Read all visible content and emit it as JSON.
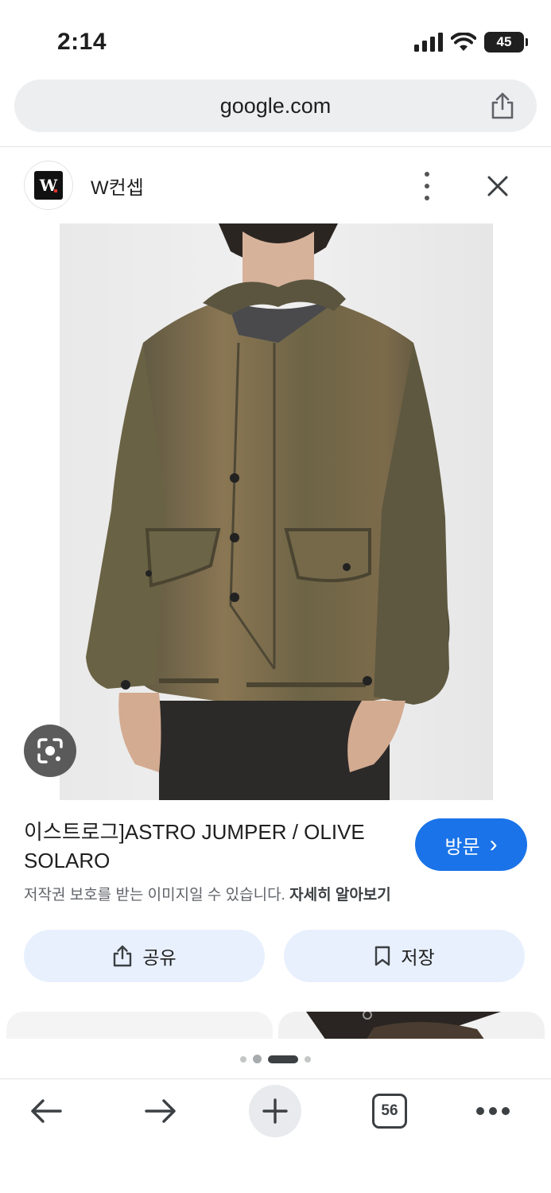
{
  "status_bar": {
    "time": "2:14",
    "battery": "45"
  },
  "address_bar": {
    "url": "google.com"
  },
  "source": {
    "name": "W컨셉",
    "logo_text": "W"
  },
  "product": {
    "title": "이스트로그]ASTRO JUMPER / OLIVE SOLARO",
    "visit_label": "방문",
    "visit_chevron": "›",
    "copyright_text": "저작권 보호를 받는 이미지일 수 있습니다.",
    "learn_more": "자세히 알아보기"
  },
  "actions": {
    "share_label": "공유",
    "save_label": "저장"
  },
  "pager": {
    "count": 4,
    "active_index": 2
  },
  "toolbar": {
    "tab_count": "56"
  },
  "icons": [
    "signal-icon",
    "wifi-icon",
    "battery-icon",
    "share-icon",
    "more-vert-icon",
    "close-icon",
    "lens-icon",
    "chevron-right-icon",
    "bookmark-icon",
    "back-icon",
    "forward-icon",
    "plus-icon",
    "tabs-icon",
    "more-horiz-icon"
  ],
  "colors": {
    "accent": "#1a73e8",
    "action_bg": "#e8f0fe",
    "address_bg": "#eceef0",
    "jacket": "#6b5f41"
  }
}
